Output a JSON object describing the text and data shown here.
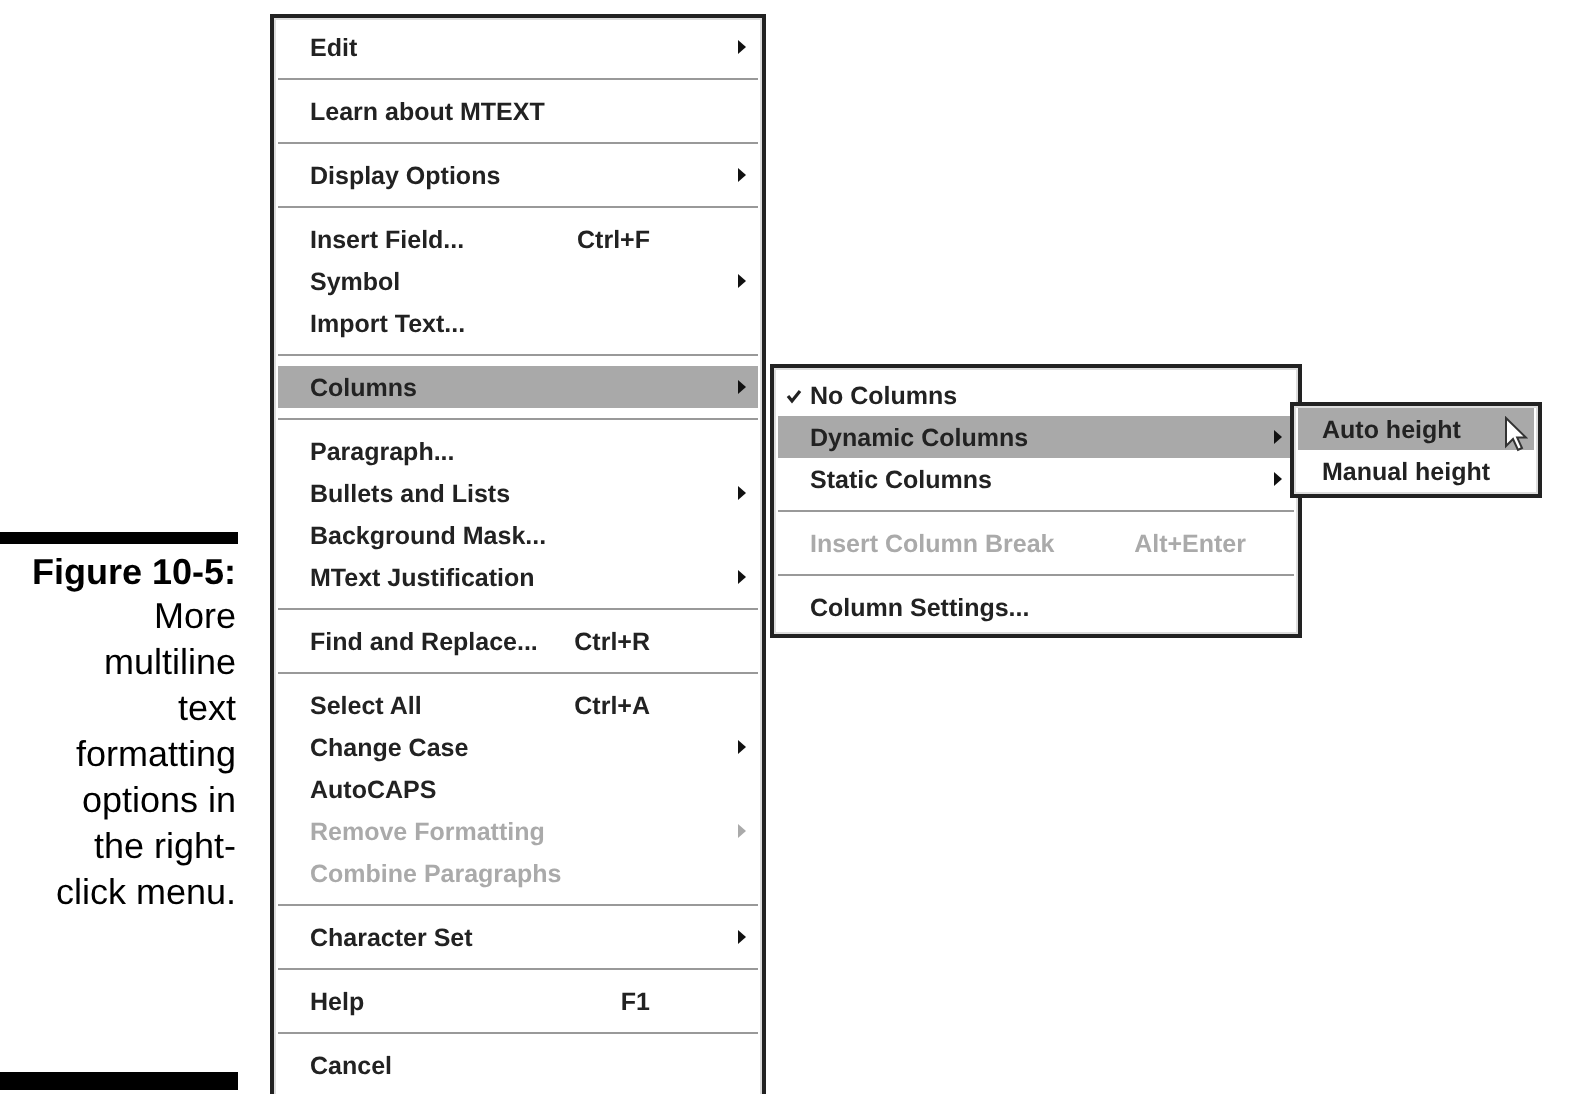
{
  "figure": {
    "label": "Figure 10-5:",
    "caption": "More multiline text formatting options in the right-click menu."
  },
  "menus": [
    {
      "kind": "main",
      "items": [
        {
          "kind": "item",
          "label": "Edit",
          "submenu": true,
          "disabled": false,
          "highlighted": false
        },
        {
          "kind": "separator"
        },
        {
          "kind": "item",
          "label": "Learn about MTEXT",
          "submenu": false,
          "disabled": false,
          "highlighted": false
        },
        {
          "kind": "separator"
        },
        {
          "kind": "item",
          "label": "Display Options",
          "submenu": true,
          "disabled": false,
          "highlighted": false
        },
        {
          "kind": "separator"
        },
        {
          "kind": "item",
          "label": "Insert Field...",
          "shortcut": "Ctrl+F",
          "submenu": false,
          "disabled": false,
          "highlighted": false
        },
        {
          "kind": "item",
          "label": "Symbol",
          "submenu": true,
          "disabled": false,
          "highlighted": false
        },
        {
          "kind": "item",
          "label": "Import Text...",
          "submenu": false,
          "disabled": false,
          "highlighted": false
        },
        {
          "kind": "separator"
        },
        {
          "kind": "item",
          "label": "Columns",
          "submenu": true,
          "disabled": false,
          "highlighted": true
        },
        {
          "kind": "separator"
        },
        {
          "kind": "item",
          "label": "Paragraph...",
          "submenu": false,
          "disabled": false,
          "highlighted": false
        },
        {
          "kind": "item",
          "label": "Bullets and Lists",
          "submenu": true,
          "disabled": false,
          "highlighted": false
        },
        {
          "kind": "item",
          "label": "Background Mask...",
          "submenu": false,
          "disabled": false,
          "highlighted": false
        },
        {
          "kind": "item",
          "label": "MText Justification",
          "submenu": true,
          "disabled": false,
          "highlighted": false
        },
        {
          "kind": "separator"
        },
        {
          "kind": "item",
          "label": "Find and Replace...",
          "shortcut": "Ctrl+R",
          "submenu": false,
          "disabled": false,
          "highlighted": false
        },
        {
          "kind": "separator"
        },
        {
          "kind": "item",
          "label": "Select All",
          "shortcut": "Ctrl+A",
          "submenu": false,
          "disabled": false,
          "highlighted": false
        },
        {
          "kind": "item",
          "label": "Change Case",
          "submenu": true,
          "disabled": false,
          "highlighted": false
        },
        {
          "kind": "item",
          "label": "AutoCAPS",
          "submenu": false,
          "disabled": false,
          "highlighted": false
        },
        {
          "kind": "item",
          "label": "Remove Formatting",
          "submenu": true,
          "disabled": true,
          "highlighted": false
        },
        {
          "kind": "item",
          "label": "Combine Paragraphs",
          "submenu": false,
          "disabled": true,
          "highlighted": false
        },
        {
          "kind": "separator"
        },
        {
          "kind": "item",
          "label": "Character Set",
          "submenu": true,
          "disabled": false,
          "highlighted": false
        },
        {
          "kind": "separator"
        },
        {
          "kind": "item",
          "label": "Help",
          "shortcut": "F1",
          "submenu": false,
          "disabled": false,
          "highlighted": false
        },
        {
          "kind": "separator"
        },
        {
          "kind": "item",
          "label": "Cancel",
          "submenu": false,
          "disabled": false,
          "highlighted": false
        }
      ]
    },
    {
      "kind": "submenu",
      "items": [
        {
          "kind": "item",
          "label": "No Columns",
          "checked": true,
          "submenu": false,
          "disabled": false,
          "highlighted": false
        },
        {
          "kind": "item",
          "label": "Dynamic Columns",
          "checked": false,
          "submenu": true,
          "disabled": false,
          "highlighted": true
        },
        {
          "kind": "item",
          "label": "Static Columns",
          "checked": false,
          "submenu": true,
          "disabled": false,
          "highlighted": false
        },
        {
          "kind": "separator"
        },
        {
          "kind": "item",
          "label": "Insert Column Break",
          "shortcut": "Alt+Enter",
          "checked": false,
          "submenu": false,
          "disabled": true,
          "highlighted": false
        },
        {
          "kind": "separator"
        },
        {
          "kind": "item",
          "label": "Column Settings...",
          "checked": false,
          "submenu": false,
          "disabled": false,
          "highlighted": false
        }
      ]
    },
    {
      "kind": "submenu",
      "items": [
        {
          "kind": "item",
          "label": "Auto height",
          "submenu": false,
          "disabled": false,
          "highlighted": true
        },
        {
          "kind": "item",
          "label": "Manual height",
          "submenu": false,
          "disabled": false,
          "highlighted": false
        }
      ]
    }
  ]
}
